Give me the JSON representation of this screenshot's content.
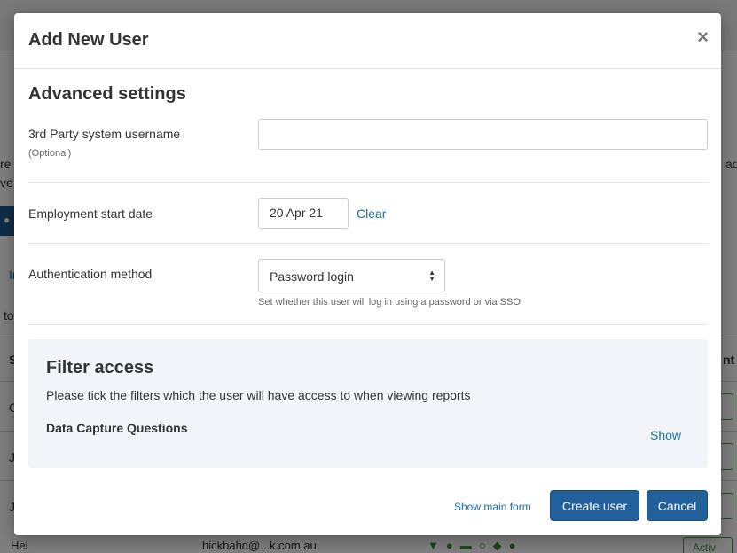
{
  "background": {
    "fragments": [
      "re",
      "ve",
      "In",
      "to",
      "S",
      "C",
      "Jo",
      "Jo",
      "ad",
      "nt"
    ],
    "row_button_glyph": "e",
    "bottom_row": {
      "name": "Hel",
      "email": "hickbahd@...k.com.au",
      "active_label": "Activ"
    }
  },
  "modal": {
    "title": "Add New User",
    "close_glyph": "×",
    "advanced": {
      "heading": "Advanced settings",
      "username": {
        "label": "3rd Party system username",
        "hint": "(Optional)",
        "value": "",
        "placeholder": ""
      },
      "start_date": {
        "label": "Employment start date",
        "value": "20 Apr 21",
        "clear_label": "Clear"
      },
      "auth": {
        "label": "Authentication method",
        "selected": "Password login",
        "hint": "Set whether this user will log in using a password or via SSO"
      }
    },
    "filter": {
      "heading": "Filter access",
      "description": "Please tick the filters which the user will have access to when viewing reports",
      "group_label": "Data Capture Questions",
      "show_label": "Show"
    },
    "footer": {
      "show_main_form": "Show main form",
      "create_label": "Create user",
      "cancel_label": "Cancel"
    }
  },
  "colors": {
    "primary": "#22609c",
    "link": "#1d6fa5",
    "panel": "#f1f5f9"
  }
}
